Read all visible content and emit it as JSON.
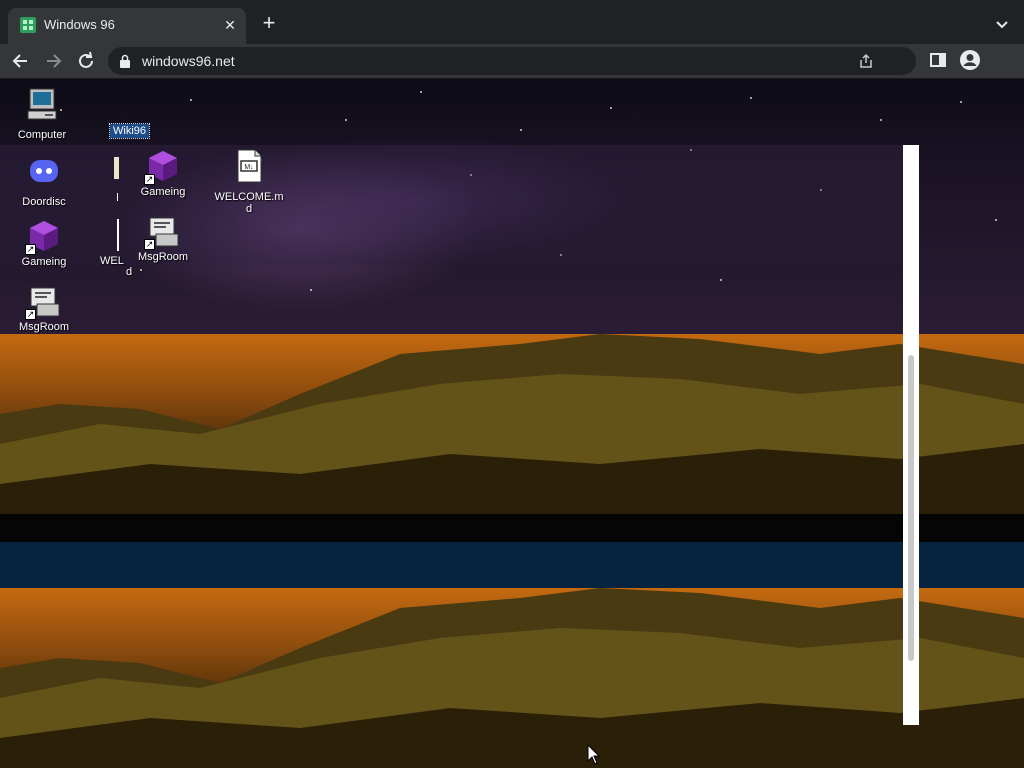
{
  "browser": {
    "tab_title": "Windows 96",
    "tab_close_glyph": "✕",
    "new_tab_glyph": "+",
    "url": "windows96.net",
    "colors": {
      "tabstrip": "#202124",
      "toolbar": "#35363a",
      "omnibox": "#202124",
      "text": "#e8eaed"
    }
  },
  "toolbar_icons": [
    "back-arrow-icon",
    "forward-arrow-icon",
    "reload-icon",
    "lock-icon",
    "share-icon",
    "side-panel-icon",
    "profile-icon",
    "tab-search-chevron-icon"
  ],
  "desktop": {
    "selected_label": "Wiki96",
    "icons": [
      {
        "label": "Computer",
        "icon": "computer-icon"
      },
      {
        "label": "Doordisc",
        "icon": "discord-icon"
      },
      {
        "label": "Gameing",
        "icon": "cube-icon"
      },
      {
        "label": "MsgRoom",
        "icon": "msgroom-icon"
      },
      {
        "label": "Gameing",
        "icon": "cube-icon"
      },
      {
        "label": "WELCOME.md",
        "icon": "markdown-file-icon"
      },
      {
        "label": "MsgRoom",
        "icon": "msgroom-icon"
      }
    ],
    "ghost_labels": {
      "welcome_fragment": "WEL",
      "welcome_tail": "d"
    },
    "colors": {
      "selection": "#1e4d8a",
      "blue_band": "#062340",
      "sky": "#1c1426",
      "landscape": "#c46a10"
    }
  }
}
